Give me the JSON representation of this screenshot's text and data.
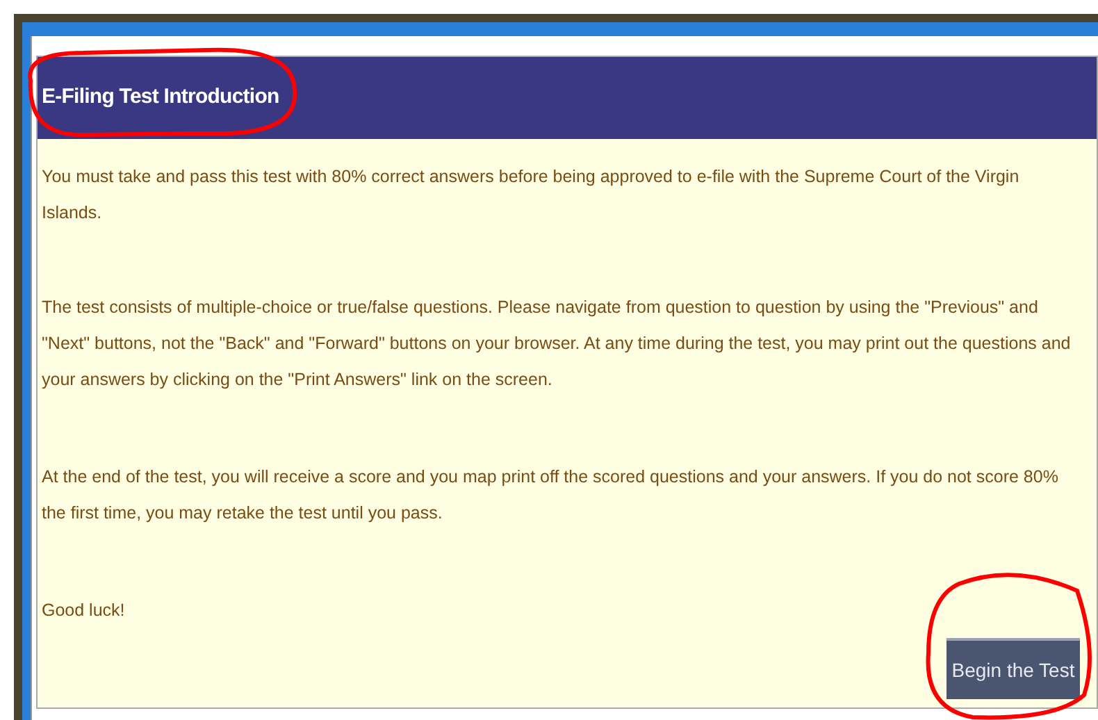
{
  "panel": {
    "title": "E-Filing Test Introduction",
    "paragraphs": [
      "You must take and pass this test with 80% correct answers before being approved to e-file with the Supreme Court of the Virgin Islands.",
      "The test consists of multiple-choice or true/false questions. Please navigate from question to question by using the \"Previous\" and \"Next\" buttons, not the \"Back\" and \"Forward\" buttons on your browser. At any time during the test, you may print out the questions and your answers by clicking on the \"Print Answers\" link on the screen.",
      "At the end of the test, you will receive a score and you map print off the scored questions and your answers. If you do not score 80% the first time, you may retake the test until you pass.",
      "Good luck!"
    ],
    "button": "Begin the Test"
  }
}
